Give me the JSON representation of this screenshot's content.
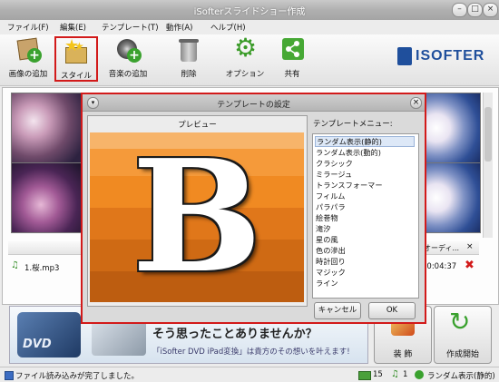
{
  "app": {
    "title": "iSofterスライドショー作成"
  },
  "menu": [
    "ファイル(F)",
    "編集(E)",
    "テンプレート(T)",
    "動作(A)",
    "ヘルプ(H)"
  ],
  "toolbar": {
    "add_image": "画像の追加",
    "style": "スタイル",
    "add_music": "音楽の追加",
    "delete": "削除",
    "options": "オプション",
    "share": "共有"
  },
  "logo": "ISOFTER",
  "music": {
    "header_audio": "オーディ...",
    "header_x": "×",
    "file": "1.桜.mp3",
    "duration": "00:04:37"
  },
  "banner": {
    "main": "そう思ったことありませんか？",
    "sub": "「iSofter DVD iPad変換」は貴方のその想いを叶えます!",
    "dvd": "DVD"
  },
  "buttons": {
    "decorate": "装 飾",
    "start": "作成開始"
  },
  "status": {
    "message": "ファイル読み込みが完了しました。",
    "image_count": "15",
    "music_count": "1",
    "template": "ランダム表示(静的)"
  },
  "dialog": {
    "title": "テンプレートの設定",
    "preview_label": "プレビュー",
    "list_label": "テンプレートメニュー:",
    "preview_letter": "B",
    "items": [
      "ランダム表示(静的)",
      "ランダム表示(動的)",
      "クラシック",
      "ミラージュ",
      "トランスフォーマー",
      "フィルム",
      "パラパラ",
      "絵巻物",
      "滝汐",
      "星の風",
      "色の滲出",
      "時計回り",
      "マジック",
      "ライン"
    ],
    "selected_index": 0,
    "cancel": "キャンセル",
    "ok": "OK"
  },
  "colors": {
    "highlight": "#d21a1a",
    "orange_light": "#f7a74a",
    "orange_dark": "#c85f12"
  }
}
